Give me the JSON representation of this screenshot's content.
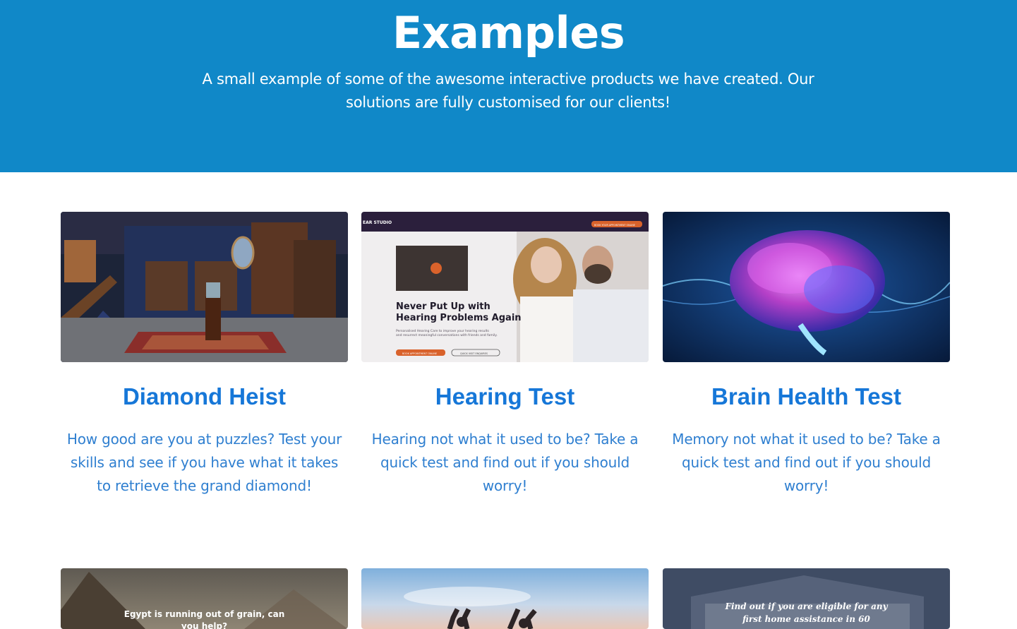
{
  "hero": {
    "title": "Examples",
    "subtitle": "A small example of some of the awesome interactive products we have created. Our solutions are fully customised for our clients!",
    "background": "#1088c8"
  },
  "cards": [
    {
      "title": "Diamond Heist",
      "description": "How good are you at puzzles? Test your skills and see if you have what it takes to retrieve the grand diamond!",
      "image": "mansion-interior-image"
    },
    {
      "title": "Hearing Test",
      "description": "Hearing not what it used to be? Take a quick test and find out if you should worry!",
      "image": "hearing-clinic-screenshot",
      "screenshot": {
        "brand": "EAR STUDIO",
        "headline_line1": "Never Put Up with",
        "headline_line2": "Hearing Problems Again",
        "body_line1": "Personalised Hearing Care to improve your hearing results",
        "body_line2": "and resurrect meaningful conversations with friends and family.",
        "cta_primary": "BOOK APPOINTMENT ONLINE",
        "cta_secondary": "QUICK VISIT ENQUIRES",
        "nav_cta": "BOOK YOUR APPOINTMENT ONLINE"
      }
    },
    {
      "title": "Brain Health Test",
      "description": "Memory not what it used to be? Take a quick test and find out if you should worry!",
      "image": "glowing-brain-image"
    }
  ],
  "row2": [
    {
      "image": "pyramids-image",
      "overlay_line1": "Egypt is running out of grain, can",
      "overlay_line2": "you help?"
    },
    {
      "image": "sunset-celebration-image"
    },
    {
      "image": "house-image",
      "overlay_line1": "Find out if you are eligible for any",
      "overlay_line2": "first home assistance in 60"
    }
  ],
  "colors": {
    "accent": "#1677d8",
    "text": "#2f7fd0"
  }
}
